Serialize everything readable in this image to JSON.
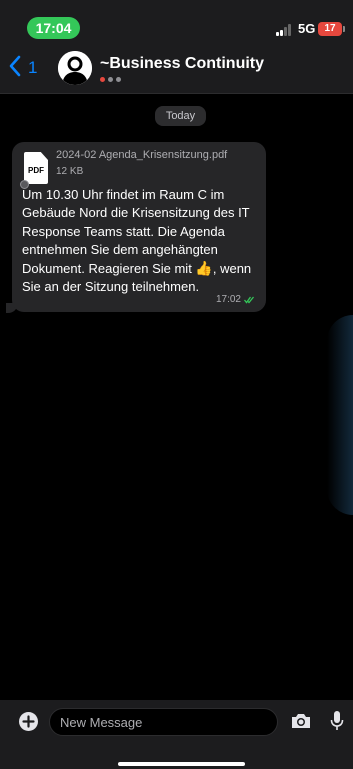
{
  "status_bar": {
    "time": "17:04",
    "network": "5G",
    "battery": "17"
  },
  "header": {
    "back_count": "1",
    "title": "~Business Continuity"
  },
  "chat": {
    "date_label": "Today",
    "message": {
      "file_icon_label": "PDF",
      "file_name": "2024-02 Agenda_Krisensitzung.pdf",
      "file_size": "12 KB",
      "text_before": "Um 10.30 Uhr findet im Raum C im Gebäude Nord die Krisensitzung des IT Response Teams statt. Die Agenda entnehmen Sie dem angehängten Dokument. Reagieren Sie mit ",
      "emoji": "👍",
      "text_after": ", wenn Sie an der Sitzung teilnehmen.",
      "time": "17:02"
    }
  },
  "input_bar": {
    "placeholder": "New Message"
  },
  "colors": {
    "accent": "#0a84ff",
    "status_green": "#34c759",
    "battery_red": "#e6483e",
    "bubble": "#262628"
  }
}
